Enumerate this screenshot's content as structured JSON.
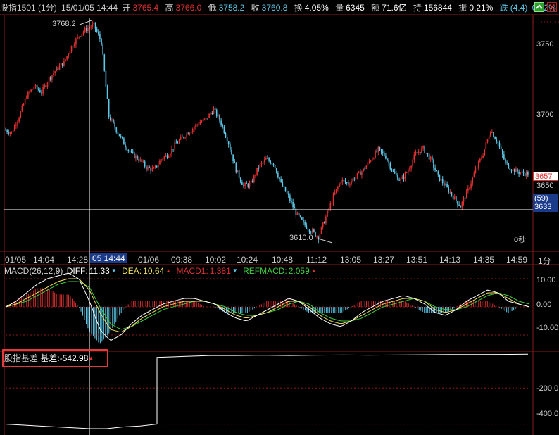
{
  "header": {
    "symbol": "股指1501 (1分)",
    "datetime": "15/01/05 14:44",
    "open_label": "开",
    "open_value": "3765.4",
    "high_label": "高",
    "high_value": "3766.0",
    "low_label": "低",
    "low_value": "3758.2",
    "close_label": "收",
    "close_value": "3760.8",
    "turnover_label": "换",
    "turnover_value": "4.05%",
    "volume_label": "量",
    "volume_value": "6345",
    "amount_label": "额",
    "amount_value": "71.6亿",
    "position_label": "持",
    "position_value": "156844",
    "amplitude_label": "振",
    "amplitude_value": "0.21%",
    "change_label": "跌",
    "change_value": "(4.4)",
    "change_pct": "0.12%"
  },
  "main_chart": {
    "high_marker": "3768.2",
    "low_marker": "3610.0",
    "countdown": "0秒",
    "y_ticks": [
      "3750",
      "3700",
      "3650"
    ],
    "current_price_tag": "3657",
    "crosshair_tags": [
      "(59)",
      "3633"
    ],
    "period_label": "1分",
    "cursor_time_label": "05 14:44",
    "x_labels": [
      "01/05",
      "14:04",
      "14:28",
      "01/06",
      "09:38",
      "10:02",
      "10:24",
      "10:48",
      "11:12",
      "13:05",
      "13:27",
      "13:51",
      "14:13",
      "14:35",
      "14:59"
    ]
  },
  "macd": {
    "title": "MACD(26,12,9)",
    "diff_label": "DIFF:",
    "diff_value": "11.33",
    "dea_label": "DEA:",
    "dea_value": "10.64",
    "macd1_label": "MACD1:",
    "macd1_value": "1.381",
    "refmacd_label": "REFMACD:",
    "refmacd_value": "2.059",
    "y_ticks": [
      "10.00",
      "0.00",
      "-10.00"
    ]
  },
  "basis": {
    "title": "股指基差",
    "value_label": "基差:",
    "value": "-542.98",
    "y_ticks": [
      "-200.0",
      "-400.0"
    ]
  },
  "colors": {
    "up": "#e03030",
    "down": "#5ec8e8",
    "macd_pos": "#e03030",
    "macd_neg": "#5ec8e8",
    "diff_line": "#ffffff",
    "dea_line": "#f0e060",
    "refmacd_line": "#3fcf3f",
    "grid": "#8b1a1a",
    "highlight_box": "#e23b3b"
  },
  "icons": [
    "chevron-up-icon",
    "close-icon"
  ],
  "chart_data": [
    {
      "type": "candlestick",
      "title": "股指1501 (1分)",
      "ylim": [
        3600,
        3775
      ],
      "x": [
        "01/05",
        "14:04",
        "14:28",
        "01/06",
        "09:38",
        "10:02",
        "10:24",
        "10:48",
        "11:12",
        "13:05",
        "13:27",
        "13:51",
        "14:13",
        "14:35",
        "14:59"
      ],
      "series": [
        {
          "name": "close",
          "values": [
            3690,
            3688,
            3700,
            3715,
            3722,
            3718,
            3728,
            3735,
            3740,
            3752,
            3760,
            3765,
            3768,
            3755,
            3700,
            3690,
            3680,
            3672,
            3668,
            3662,
            3660,
            3668,
            3672,
            3680,
            3685,
            3690,
            3695,
            3698,
            3705,
            3695,
            3680,
            3660,
            3648,
            3650,
            3662,
            3668,
            3665,
            3650,
            3640,
            3628,
            3620,
            3615,
            3610,
            3625,
            3640,
            3652,
            3650,
            3655,
            3660,
            3668,
            3675,
            3670,
            3658,
            3652,
            3660,
            3672,
            3676,
            3668,
            3655,
            3648,
            3640,
            3633,
            3645,
            3660,
            3672,
            3690,
            3680,
            3665,
            3660,
            3658,
            3657
          ]
        }
      ]
    },
    {
      "type": "line",
      "title": "MACD(26,12,9)",
      "ylim": [
        -15,
        14
      ],
      "series": [
        {
          "name": "DIFF",
          "values": [
            0,
            2,
            5,
            8,
            10,
            11,
            12,
            10,
            2,
            -8,
            -12,
            -10,
            -6,
            -3,
            -1,
            1,
            2,
            3,
            3,
            2,
            1,
            -2,
            -4,
            -5,
            -3,
            -1,
            1,
            3,
            2,
            -1,
            -4,
            -6,
            -7,
            -5,
            -2,
            0,
            2,
            3,
            4,
            3,
            1,
            -2,
            -3,
            -1,
            2,
            4,
            6,
            5,
            2,
            1,
            0
          ]
        },
        {
          "name": "DEA",
          "values": [
            0,
            1,
            3,
            5,
            7,
            9,
            10,
            10,
            6,
            -2,
            -8,
            -9,
            -7,
            -4,
            -2,
            0,
            1,
            2,
            2,
            2,
            1,
            -1,
            -3,
            -4,
            -3,
            -2,
            0,
            2,
            2,
            0,
            -3,
            -5,
            -6,
            -5,
            -3,
            -1,
            1,
            2,
            3,
            3,
            2,
            -1,
            -2,
            -1,
            1,
            3,
            5,
            5,
            3,
            1,
            0
          ]
        },
        {
          "name": "REFMACD",
          "values": [
            0,
            1,
            2,
            4,
            6,
            8,
            9,
            9,
            7,
            0,
            -6,
            -8,
            -7,
            -5,
            -3,
            -1,
            0,
            1,
            2,
            2,
            1,
            0,
            -2,
            -3,
            -3,
            -2,
            -1,
            1,
            2,
            1,
            -2,
            -4,
            -5,
            -5,
            -4,
            -2,
            0,
            1,
            2,
            3,
            2,
            0,
            -1,
            -1,
            0,
            2,
            4,
            5,
            4,
            2,
            1
          ]
        }
      ]
    },
    {
      "type": "line",
      "title": "股指基差",
      "ylim": [
        -460,
        0
      ],
      "series": [
        {
          "name": "基差",
          "values": [
            -400,
            -405,
            -410,
            -415,
            -420,
            -425,
            -425,
            -415,
            -410,
            -400,
            -30,
            -25,
            -20,
            -20,
            -18,
            -20,
            -18,
            -17,
            -18,
            -17,
            -16,
            -15,
            -15,
            -14,
            -13
          ]
        }
      ]
    }
  ]
}
